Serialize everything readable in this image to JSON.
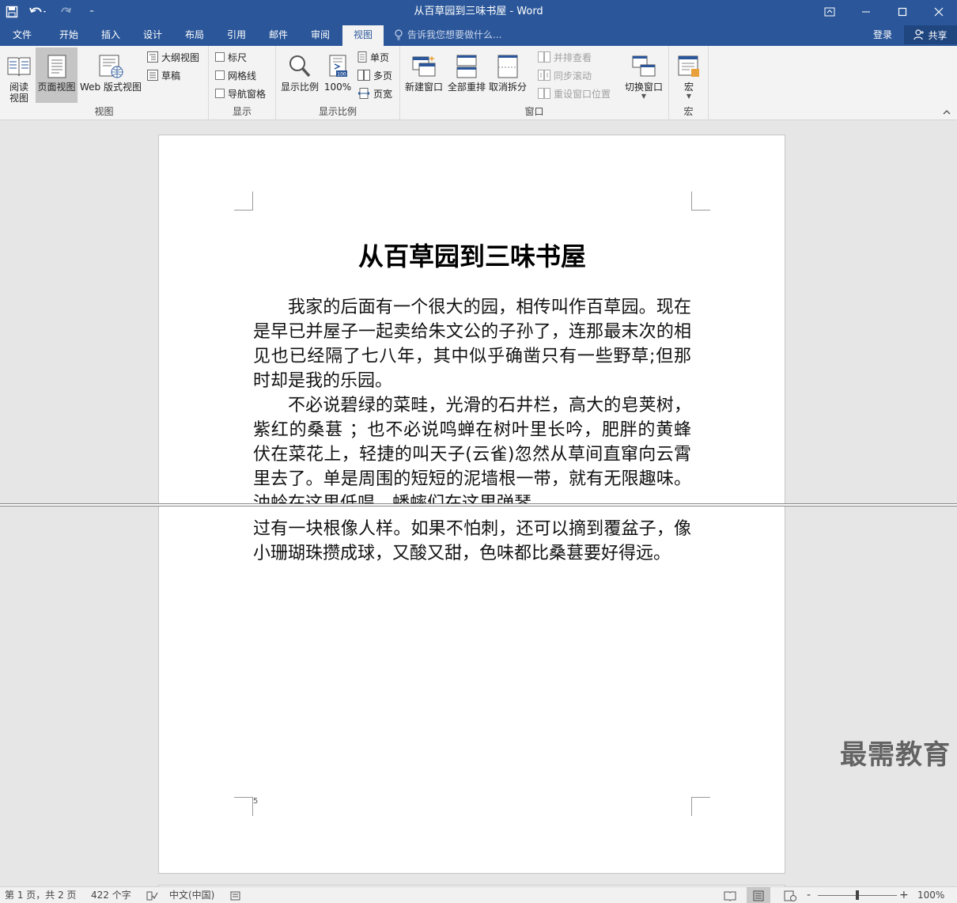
{
  "window": {
    "title": "从百草园到三味书屋 - Word",
    "qat_more": "⁼"
  },
  "tabs": [
    {
      "label": "文件"
    },
    {
      "label": "开始"
    },
    {
      "label": "插入"
    },
    {
      "label": "设计"
    },
    {
      "label": "布局"
    },
    {
      "label": "引用"
    },
    {
      "label": "邮件"
    },
    {
      "label": "审阅"
    },
    {
      "label": "视图"
    }
  ],
  "tell_me": "告诉我您想要做什么...",
  "account": {
    "sign_in": "登录",
    "share": "共享"
  },
  "ribbon": {
    "views": {
      "label": "视图",
      "read_mode": "阅读\n视图",
      "print_layout": "页面视图",
      "web_layout": "Web 版式视图",
      "outline": "大纲视图",
      "draft": "草稿"
    },
    "show": {
      "label": "显示",
      "ruler": "标尺",
      "gridlines": "网格线",
      "nav_pane": "导航窗格"
    },
    "zoom": {
      "label": "显示比例",
      "zoom": "显示比例",
      "zoom_100": "100%",
      "one_page": "单页",
      "multi_page": "多页",
      "page_width": "页宽"
    },
    "window": {
      "label": "窗口",
      "new_window": "新建窗口",
      "arrange_all": "全部重排",
      "remove_split": "取消拆分",
      "side_by_side": "并排查看",
      "sync_scroll": "同步滚动",
      "reset_position": "重设窗口位置",
      "switch_windows": "切换窗口"
    },
    "macros": {
      "label": "宏",
      "macros": "宏"
    }
  },
  "document": {
    "title": "从百草园到三味书屋",
    "paragraphs": [
      "我家的后面有一个很大的园，相传叫作百草园。现在是早已并屋子一起卖给朱文公的子孙了，连那最末次的相见也已经隔了七八年，其中似乎确凿只有一些野草;但那时却是我的乐园。",
      "不必说碧绿的菜畦，光滑的石井栏，高大的皂荚树，紫红的桑葚 ；也不必说鸣蝉在树叶里长吟，肥胖的黄蜂伏在菜花上，轻捷的叫天子(云雀)忽然从草间直窜向云霄里去了。单是周围的短短的泥墙根一带，就有无限趣味。油蛉在这里低唱，蟋蟀们在这里弹琴。"
    ],
    "lower_pane_paragraph": "过有一块根像人样。如果不怕刺，还可以摘到覆盆子，像小珊瑚珠攒成球，又酸又甜，色味都比桑葚要好得远。",
    "page_number": "5"
  },
  "watermark": "最需教育",
  "status": {
    "page": "第 1 页，共 2 页",
    "words": "422 个字",
    "language": "中文(中国)",
    "zoom": "100%",
    "zoom_level_percent": 100
  }
}
